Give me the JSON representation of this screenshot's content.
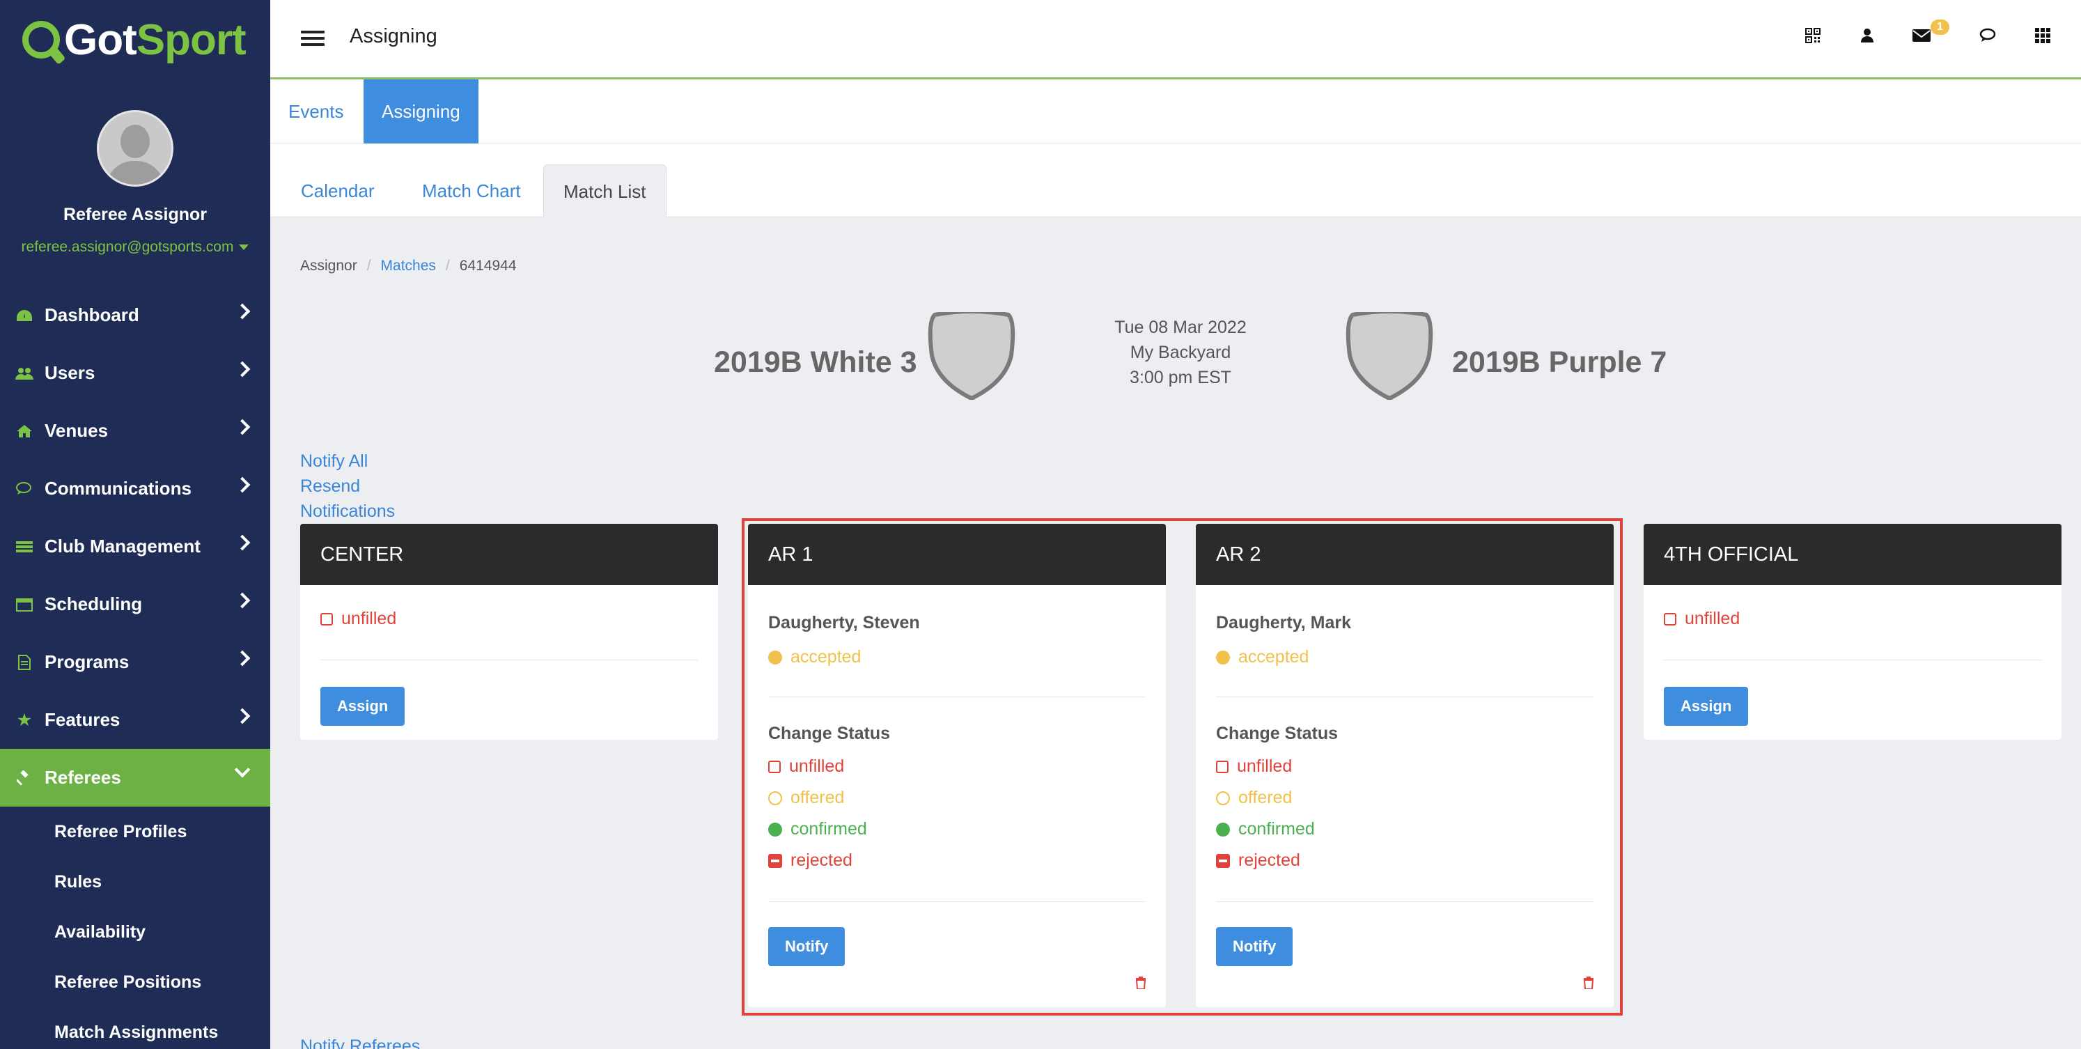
{
  "brand": {
    "got": "Got",
    "sport": "Sport"
  },
  "profile": {
    "name": "Referee Assignor",
    "email": "referee.assignor@gotsports.com"
  },
  "sidebar": {
    "items": [
      {
        "label": "Dashboard",
        "icon": "dashboard-icon"
      },
      {
        "label": "Users",
        "icon": "users-icon"
      },
      {
        "label": "Venues",
        "icon": "home-icon"
      },
      {
        "label": "Communications",
        "icon": "chat-icon"
      },
      {
        "label": "Club Management",
        "icon": "list-icon"
      },
      {
        "label": "Scheduling",
        "icon": "calendar-icon"
      },
      {
        "label": "Programs",
        "icon": "document-icon"
      },
      {
        "label": "Features",
        "icon": "star-icon"
      },
      {
        "label": "Referees",
        "icon": "gavel-icon"
      }
    ],
    "sub_items": [
      "Referee Profiles",
      "Rules",
      "Availability",
      "Referee Positions",
      "Match Assignments"
    ]
  },
  "topbar": {
    "title": "Assigning",
    "mail_badge": "1"
  },
  "tabs_primary": [
    "Events",
    "Assigning"
  ],
  "tabs_secondary": [
    "Calendar",
    "Match Chart",
    "Match List"
  ],
  "breadcrumb": {
    "root": "Assignor",
    "matches": "Matches",
    "id": "6414944"
  },
  "match": {
    "home_team": "2019B White 3",
    "away_team": "2019B Purple 7",
    "date": "Tue 08 Mar 2022",
    "venue": "My Backyard",
    "time": "3:00 pm EST"
  },
  "notify_links": {
    "notify_all": "Notify All",
    "resend": "Resend",
    "notifications": "Notifications",
    "notify_referees": "Notify Referees"
  },
  "cards": {
    "center": {
      "title": "CENTER",
      "status": "unfilled",
      "button": "Assign"
    },
    "ar1": {
      "title": "AR 1",
      "person": "Daugherty, Steven",
      "status": "accepted",
      "change_label": "Change Status",
      "button": "Notify"
    },
    "ar2": {
      "title": "AR 2",
      "person": "Daugherty, Mark",
      "status": "accepted",
      "change_label": "Change Status",
      "button": "Notify"
    },
    "fourth": {
      "title": "4TH OFFICIAL",
      "status": "unfilled",
      "button": "Assign"
    }
  },
  "status_options": {
    "unfilled": "unfilled",
    "offered": "offered",
    "confirmed": "confirmed",
    "rejected": "rejected"
  },
  "colors": {
    "sidebar_bg": "#1f2c55",
    "brand_green": "#7cc243",
    "primary_blue": "#3f8ddf",
    "danger_red": "#e0433a",
    "warning_yellow": "#f0c14b",
    "success_green": "#4cb050"
  }
}
